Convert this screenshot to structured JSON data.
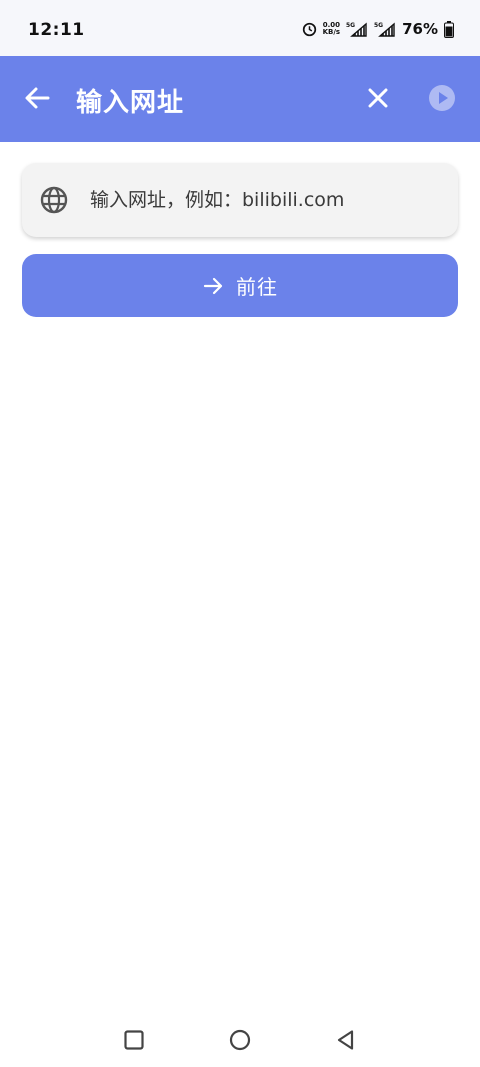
{
  "status_bar": {
    "time": "12:11",
    "net_speed_value": "0.00",
    "net_speed_unit": "KB/s",
    "sim1_label": "5G",
    "sim2_label": "5G",
    "battery_percent": "76%"
  },
  "app_bar": {
    "title": "输入网址",
    "back_icon": "arrow-left-icon",
    "close_icon": "close-icon",
    "play_icon": "play-circle-icon"
  },
  "url_input": {
    "placeholder": "输入网址，例如：bilibili.com",
    "value": "",
    "icon": "globe-icon"
  },
  "go_button": {
    "label": "前往",
    "icon": "arrow-right-icon"
  },
  "nav_bar": {
    "recent_icon": "square-icon",
    "home_icon": "circle-icon",
    "back_icon": "triangle-back-icon"
  },
  "colors": {
    "accent": "#6b82ea",
    "card_bg": "#f3f3f3",
    "text": "#3a3a3a"
  }
}
